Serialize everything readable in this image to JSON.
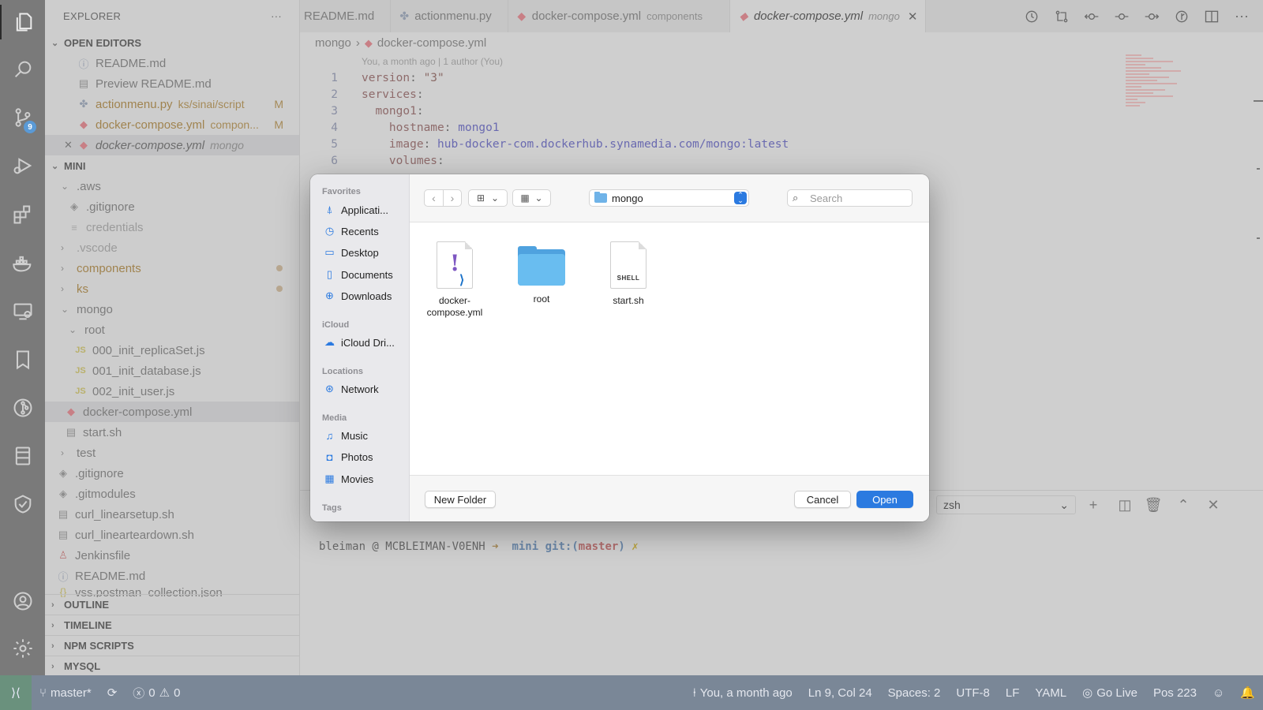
{
  "sidebar": {
    "title": "EXPLORER",
    "more": "···",
    "open_editors": {
      "header": "OPEN EDITORS",
      "items": [
        {
          "name": "README.md",
          "detail": "",
          "status": ""
        },
        {
          "name": "Preview README.md",
          "detail": "",
          "status": ""
        },
        {
          "name": "actionmenu.py",
          "detail": "ks/sinai/script",
          "status": "M"
        },
        {
          "name": "docker-compose.yml",
          "detail": "compon...",
          "status": "M"
        },
        {
          "name": "docker-compose.yml",
          "detail": "mongo",
          "status": ""
        }
      ]
    },
    "workspace": {
      "header": "MINI",
      "items": [
        {
          "name": ".aws"
        },
        {
          "name": ".gitignore"
        },
        {
          "name": "credentials"
        },
        {
          "name": ".vscode"
        },
        {
          "name": "components"
        },
        {
          "name": "ks"
        },
        {
          "name": "mongo"
        },
        {
          "name": "root"
        },
        {
          "name": "000_init_replicaSet.js"
        },
        {
          "name": "001_init_database.js"
        },
        {
          "name": "002_init_user.js"
        },
        {
          "name": "docker-compose.yml"
        },
        {
          "name": "start.sh"
        },
        {
          "name": "test"
        },
        {
          "name": ".gitignore"
        },
        {
          "name": ".gitmodules"
        },
        {
          "name": "curl_linearsetup.sh"
        },
        {
          "name": "curl_linearteardown.sh"
        },
        {
          "name": "Jenkinsfile"
        },
        {
          "name": "README.md"
        },
        {
          "name": "vss.postman_collection.json"
        }
      ]
    },
    "sections": [
      "OUTLINE",
      "TIMELINE",
      "NPM SCRIPTS",
      "MYSQL"
    ]
  },
  "activity": {
    "scm_badge": "9"
  },
  "tabs": [
    {
      "label": "README.md",
      "detail": ""
    },
    {
      "label": "actionmenu.py",
      "detail": ""
    },
    {
      "label": "docker-compose.yml",
      "detail": "components"
    },
    {
      "label": "docker-compose.yml",
      "detail": "mongo",
      "close": "✕"
    }
  ],
  "editor": {
    "breadcrumb": {
      "folder": "mongo",
      "sep": "›",
      "file": "docker-compose.yml"
    },
    "blame": "You, a month ago | 1 author (You)",
    "lines": [
      {
        "n": "1",
        "key": "version",
        "val": "\"3\""
      },
      {
        "n": "2",
        "key": "services",
        "val": ""
      },
      {
        "n": "3",
        "key": "  mongo1",
        "val": ""
      },
      {
        "n": "4",
        "key": "    hostname",
        "val": "mongo1"
      },
      {
        "n": "5",
        "key": "    image",
        "val": "hub-docker-com.dockerhub.synamedia.com/mongo:latest"
      },
      {
        "n": "6",
        "key": "    volumes",
        "val": ""
      }
    ]
  },
  "terminal": {
    "shell": "zsh",
    "prompt_user": "bleiman @ MCBLEIMAN-V0ENH",
    "prompt_arrow": "➜",
    "prompt_dir": "mini",
    "prompt_git": "git:(",
    "prompt_branch": "master",
    "prompt_git_close": ")",
    "prompt_dirty": "✗"
  },
  "statusbar": {
    "remote": "⟩⟨",
    "branch": "master*",
    "errors": "0",
    "warnings": "0",
    "blame": "You, a month ago",
    "position": "Ln 9, Col 24",
    "spaces": "Spaces: 2",
    "encoding": "UTF-8",
    "eol": "LF",
    "language": "YAML",
    "golive": "Go Live",
    "pos": "Pos 223"
  },
  "dialog": {
    "sidebar": {
      "favorites_label": "Favorites",
      "favorites": [
        "Applicati...",
        "Recents",
        "Desktop",
        "Documents",
        "Downloads"
      ],
      "icloud_label": "iCloud",
      "icloud": [
        "iCloud Dri..."
      ],
      "locations_label": "Locations",
      "locations": [
        "Network"
      ],
      "media_label": "Media",
      "media": [
        "Music",
        "Photos",
        "Movies"
      ],
      "tags_label": "Tags"
    },
    "location": "mongo",
    "search_placeholder": "Search",
    "files": [
      {
        "name": "docker-compose.yml",
        "line1": "docker-",
        "line2": "compose.yml"
      },
      {
        "name": "root"
      },
      {
        "name": "start.sh",
        "badge": "SHELL"
      }
    ],
    "new_folder": "New Folder",
    "cancel": "Cancel",
    "open": "Open"
  }
}
